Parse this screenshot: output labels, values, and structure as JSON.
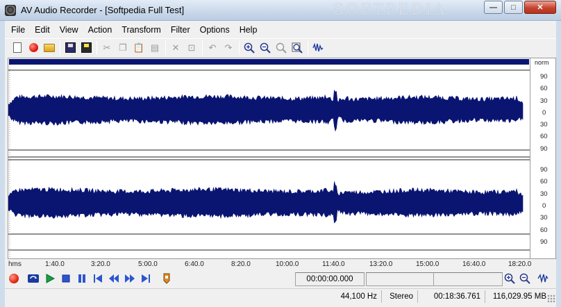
{
  "window": {
    "title": "AV Audio Recorder - [Softpedia Full Test]",
    "watermark": "SOFTPEDIA",
    "minimize_glyph": "—",
    "maximize_glyph": "□",
    "close_glyph": "✕"
  },
  "menu": {
    "items": [
      "File",
      "Edit",
      "View",
      "Action",
      "Transform",
      "Filter",
      "Options",
      "Help"
    ]
  },
  "toolbar": {
    "buttons": [
      {
        "icon": "new-file-icon"
      },
      {
        "icon": "record-icon"
      },
      {
        "icon": "open-folder-icon"
      },
      {
        "icon": "save-icon"
      },
      {
        "icon": "save-as-icon"
      },
      {
        "icon": "cut-icon"
      },
      {
        "icon": "copy-icon"
      },
      {
        "icon": "paste-icon"
      },
      {
        "icon": "paste-mix-icon"
      },
      {
        "icon": "delete-icon"
      },
      {
        "icon": "trim-icon"
      },
      {
        "icon": "undo-icon"
      },
      {
        "icon": "redo-icon"
      },
      {
        "icon": "zoom-in-icon"
      },
      {
        "icon": "zoom-out-icon"
      },
      {
        "icon": "zoom-selection-icon"
      },
      {
        "icon": "zoom-full-icon"
      },
      {
        "icon": "effects-icon"
      }
    ]
  },
  "waveform": {
    "color": "#0a1572",
    "scale_header": "norm",
    "scale_labels_ch1": [
      "90",
      "60",
      "30",
      "0",
      "30",
      "60",
      "90"
    ],
    "scale_labels_ch2": [
      "90",
      "60",
      "30",
      "0",
      "30",
      "60",
      "90"
    ]
  },
  "timeline": {
    "unit": "hms",
    "ticks": [
      "1:40.0",
      "3:20.0",
      "5:00.0",
      "6:40.0",
      "8:20.0",
      "10:00.0",
      "11:40.0",
      "13:20.0",
      "15:00.0",
      "16:40.0",
      "18:20.0"
    ]
  },
  "transport": {
    "position": "00:00:00.000",
    "selection_start": "",
    "selection_end": ""
  },
  "status": {
    "sample_rate": "44,100 Hz",
    "channels": "Stereo",
    "length": "00:18:36.761",
    "free_space": "116,029.95 MB"
  }
}
